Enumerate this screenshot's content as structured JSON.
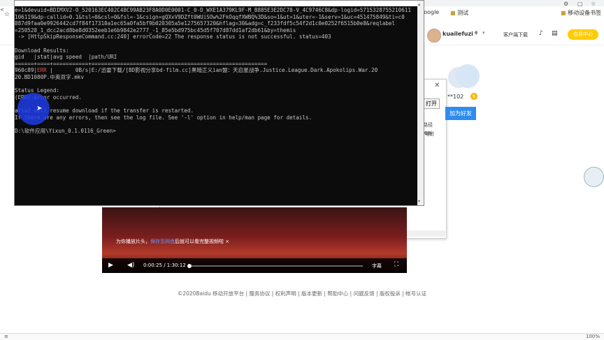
{
  "browser": {
    "bookmarks": {
      "item1": "Google",
      "item2": "测试",
      "item3": "移动设备书签"
    }
  },
  "site": {
    "username": "kuailefuzi",
    "nav1": "客户端下载",
    "vip": "会员中心"
  },
  "popup": {
    "open_btn": "打开",
    "user_suffix": "**102",
    "col_a": "路径",
    "col_b": "/电影",
    "num": "08",
    "add_friend": "加为好友"
  },
  "video": {
    "subtitle": "为你播放片头，",
    "subtitle2": "后就可以看完整视频啦 ×",
    "time": "0:00:25 / 1:30:12",
    "subtitle_btn": "字幕"
  },
  "footer": {
    "text": "©2020Baidu 移动开放平台 | 服务协议 | 权利声明 | 版本更新 | 帮助中心 | 问题反馈 | 版权投诉 | 帐号认证"
  },
  "status": {
    "zoom": "100%"
  },
  "console": {
    "lines": [
      "e=1&devuid=BDIMXV2-O_520163EC402C48C99AB23F8A0D0E0001-C_0-D_WXE1A379KL9F-M_B885E3E2DC78-V_4C9746C8&dp-logid=5715328755210611",
      "106119&dp-callid=0.1&tsl=0&csl=0&fsl=-1&csign=gQXxV9DZft0WUiSOw%2FkOqqfXWBQ%3D&so=1&ut=1&uter=-1&serv=1&uc=451475849&ti=c0",
      "887d9faa0e9926442cd7f84f17310a1ec65a0fa5bf9b020305a5e1275657320&hflag=30&adg=c_f233fdf5c54f2d1c0e0252f6515b0e8&reqlabel",
      "=250528_1_dcc2acd8be8d0352eeb1e6b9842e2777_-1_85e5bd975bc45d5f707d87dd1af2db61&by=themis",
      " -> [HttpSkipResponseCommand.cc:240] errorCode=22 The response status is not successful. status=403",
      "",
      "Download Results:",
      "gid   |stat|avg speed  |path/URI",
      "======+====+===========+=======================================================",
      "960c89|ERR |       0B/s|E:/迅雷下载/[BD影视分享bd-film.cc]黑暗正义ian盟：天启星战争.Justice.League.Dark.Apokolips.War.20",
      "20.BD1080P.中英双字.mkv",
      "",
      "Status Legend:",
      "(ERR):error occurred.",
      "",
      "aria2 will resume download if the transfer is restarted.",
      "If there are any errors, then see the log file. See '-l' option in help/man page for details.",
      "",
      "D:\\软件应用\\Yixun_0.1.0116_Green>"
    ]
  }
}
